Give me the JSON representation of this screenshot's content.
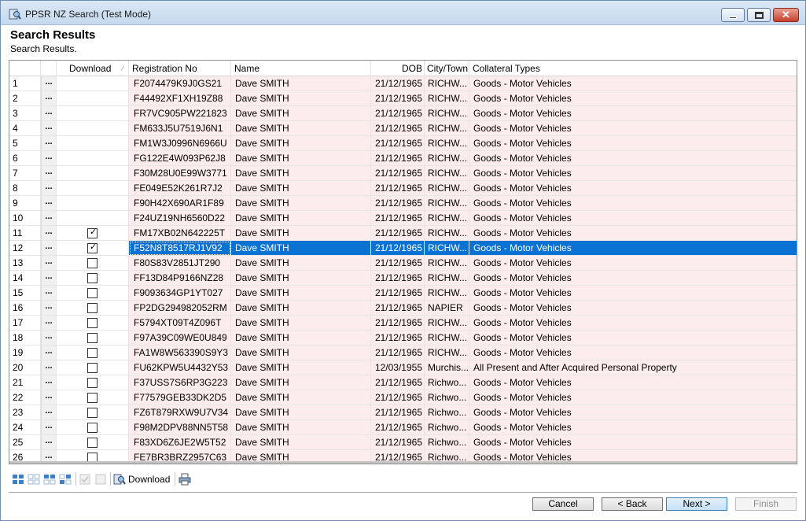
{
  "window": {
    "title": "PPSR NZ Search (Test Mode)"
  },
  "header": {
    "title": "Search Results",
    "subtitle": "Search Results."
  },
  "grid": {
    "columns": {
      "download": "Download",
      "registration": "Registration No",
      "name": "Name",
      "dob": "DOB",
      "city": "City/Town",
      "collateral": "Collateral Types"
    },
    "row_button": "...",
    "selected_row": 12,
    "rows": [
      {
        "num": "1",
        "checkbox": false,
        "checked": false,
        "reg": "F2074479K9J0GS21",
        "name": "Dave SMITH",
        "dob": "21/12/1965",
        "city": "RICHW...",
        "coll": "Goods - Motor Vehicles"
      },
      {
        "num": "2",
        "checkbox": false,
        "checked": false,
        "reg": "F44492XF1XH19Z88",
        "name": "Dave SMITH",
        "dob": "21/12/1965",
        "city": "RICHW...",
        "coll": "Goods - Motor Vehicles"
      },
      {
        "num": "3",
        "checkbox": false,
        "checked": false,
        "reg": "FR7VC905PW221823",
        "name": "Dave SMITH",
        "dob": "21/12/1965",
        "city": "RICHW...",
        "coll": "Goods - Motor Vehicles"
      },
      {
        "num": "4",
        "checkbox": false,
        "checked": false,
        "reg": "FM633J5U7519J6N1",
        "name": "Dave SMITH",
        "dob": "21/12/1965",
        "city": "RICHW...",
        "coll": "Goods - Motor Vehicles"
      },
      {
        "num": "5",
        "checkbox": false,
        "checked": false,
        "reg": "FM1W3J0996N6966U",
        "name": "Dave SMITH",
        "dob": "21/12/1965",
        "city": "RICHW...",
        "coll": "Goods - Motor Vehicles"
      },
      {
        "num": "6",
        "checkbox": false,
        "checked": false,
        "reg": "FG122E4W093P62J8",
        "name": "Dave SMITH",
        "dob": "21/12/1965",
        "city": "RICHW...",
        "coll": "Goods - Motor Vehicles"
      },
      {
        "num": "7",
        "checkbox": false,
        "checked": false,
        "reg": "F30M28U0E99W3771",
        "name": "Dave SMITH",
        "dob": "21/12/1965",
        "city": "RICHW...",
        "coll": "Goods - Motor Vehicles"
      },
      {
        "num": "8",
        "checkbox": false,
        "checked": false,
        "reg": "FE049E52K261R7J2",
        "name": "Dave SMITH",
        "dob": "21/12/1965",
        "city": "RICHW...",
        "coll": "Goods - Motor Vehicles"
      },
      {
        "num": "9",
        "checkbox": false,
        "checked": false,
        "reg": "F90H42X690AR1F89",
        "name": "Dave SMITH",
        "dob": "21/12/1965",
        "city": "RICHW...",
        "coll": "Goods - Motor Vehicles"
      },
      {
        "num": "10",
        "checkbox": false,
        "checked": false,
        "reg": "F24UZ19NH6560D22",
        "name": "Dave SMITH",
        "dob": "21/12/1965",
        "city": "RICHW...",
        "coll": "Goods - Motor Vehicles"
      },
      {
        "num": "11",
        "checkbox": true,
        "checked": true,
        "reg": "FM17XB02N642225T",
        "name": "Dave SMITH",
        "dob": "21/12/1965",
        "city": "RICHW...",
        "coll": "Goods - Motor Vehicles"
      },
      {
        "num": "12",
        "checkbox": true,
        "checked": true,
        "reg": "F52N8T8517RJ1V92",
        "name": "Dave SMITH",
        "dob": "21/12/1965",
        "city": "RICHW...",
        "coll": "Goods - Motor Vehicles"
      },
      {
        "num": "13",
        "checkbox": true,
        "checked": false,
        "reg": "F80S83V2851JT290",
        "name": "Dave SMITH",
        "dob": "21/12/1965",
        "city": "RICHW...",
        "coll": "Goods - Motor Vehicles"
      },
      {
        "num": "14",
        "checkbox": true,
        "checked": false,
        "reg": "FF13D84P9166NZ28",
        "name": "Dave SMITH",
        "dob": "21/12/1965",
        "city": "RICHW...",
        "coll": "Goods - Motor Vehicles"
      },
      {
        "num": "15",
        "checkbox": true,
        "checked": false,
        "reg": "F9093634GP1YT027",
        "name": "Dave SMITH",
        "dob": "21/12/1965",
        "city": "RICHW...",
        "coll": "Goods - Motor Vehicles"
      },
      {
        "num": "16",
        "checkbox": true,
        "checked": false,
        "reg": "FP2DG294982052RM",
        "name": "Dave SMITH",
        "dob": "21/12/1965",
        "city": "NAPIER",
        "coll": "Goods - Motor Vehicles"
      },
      {
        "num": "17",
        "checkbox": true,
        "checked": false,
        "reg": "F5794XT09T4Z096T",
        "name": "Dave SMITH",
        "dob": "21/12/1965",
        "city": "RICHW...",
        "coll": "Goods - Motor Vehicles"
      },
      {
        "num": "18",
        "checkbox": true,
        "checked": false,
        "reg": "F97A39C09WE0U849",
        "name": "Dave SMITH",
        "dob": "21/12/1965",
        "city": "RICHW...",
        "coll": "Goods - Motor Vehicles"
      },
      {
        "num": "19",
        "checkbox": true,
        "checked": false,
        "reg": "FA1W8W563390S9Y3",
        "name": "Dave SMITH",
        "dob": "21/12/1965",
        "city": "RICHW...",
        "coll": "Goods - Motor Vehicles"
      },
      {
        "num": "20",
        "checkbox": true,
        "checked": false,
        "reg": "FU62KPW5U4432Y53",
        "name": "Dave SMITH",
        "dob": "12/03/1955",
        "city": "Murchis...",
        "coll": "All Present and After Acquired Personal Property"
      },
      {
        "num": "21",
        "checkbox": true,
        "checked": false,
        "reg": "F37USS7S6RP3G223",
        "name": "Dave SMITH",
        "dob": "21/12/1965",
        "city": "Richwo...",
        "coll": "Goods - Motor Vehicles"
      },
      {
        "num": "22",
        "checkbox": true,
        "checked": false,
        "reg": "F77579GEB33DK2D5",
        "name": "Dave SMITH",
        "dob": "21/12/1965",
        "city": "Richwo...",
        "coll": "Goods - Motor Vehicles"
      },
      {
        "num": "23",
        "checkbox": true,
        "checked": false,
        "reg": "FZ6T879RXW9U7V34",
        "name": "Dave SMITH",
        "dob": "21/12/1965",
        "city": "Richwo...",
        "coll": "Goods - Motor Vehicles"
      },
      {
        "num": "24",
        "checkbox": true,
        "checked": false,
        "reg": "F98M2DPV88NN5T58",
        "name": "Dave SMITH",
        "dob": "21/12/1965",
        "city": "Richwo...",
        "coll": "Goods - Motor Vehicles"
      },
      {
        "num": "25",
        "checkbox": true,
        "checked": false,
        "reg": "F83XD6Z6JE2W5T52",
        "name": "Dave SMITH",
        "dob": "21/12/1965",
        "city": "Richwo...",
        "coll": "Goods - Motor Vehicles"
      },
      {
        "num": "26",
        "checkbox": true,
        "checked": false,
        "reg": "FE7BR3BRZ2957C63",
        "name": "Dave SMITH",
        "dob": "21/12/1965",
        "city": "Richwo...",
        "coll": "Goods - Motor Vehicles"
      }
    ]
  },
  "toolbar": {
    "download_label": "Download"
  },
  "buttons": {
    "cancel": "Cancel",
    "back": "< Back",
    "next": "Next >",
    "finish": "Finish"
  }
}
